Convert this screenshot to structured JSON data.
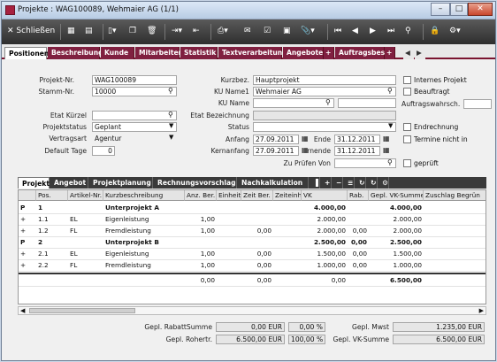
{
  "window": {
    "title": "Projekte : WAG100089, Wehmaier AG (1/1)"
  },
  "toolbar": {
    "close_label": "Schließen"
  },
  "tabs": [
    "Positionen",
    "Beschreibung",
    "Kunde",
    "Mitarbeiter",
    "Statistik",
    "Textverarbeitung",
    "Angebote",
    "Auftragsbest."
  ],
  "form": {
    "projekt_nr_label": "Projekt-Nr.",
    "projekt_nr": "WAG100089",
    "stamm_nr_label": "Stamm-Nr.",
    "stamm_nr": "10000",
    "etat_kuerzel_label": "Etat Kürzel",
    "etat_kuerzel": "",
    "projektstatus_label": "Projektstatus",
    "projektstatus": "Geplant",
    "vertragsart_label": "Vertragsart",
    "vertragsart": "Agentur",
    "default_tage_label": "Default Tage",
    "default_tage": "0",
    "kurzbez_label": "Kurzbez.",
    "kurzbez": "Hauptprojekt",
    "ku_name1_label": "KU Name1",
    "ku_name1": "Wehmaier AG",
    "ku_name_label": "KU Name",
    "ku_name": "",
    "etat_bez_label": "Etat Bezeichnung",
    "etat_bez": "",
    "status_label": "Status",
    "status": "",
    "anfang_label": "Anfang",
    "anfang": "27.09.2011",
    "ende_label": "Ende",
    "ende": "31.12.2011",
    "kernanfang_label": "Kernanfang",
    "kernanfang": "27.09.2011",
    "kernende_label": "rnende",
    "kernende": "31.12.2011",
    "zu_pruefen_label": "Zu Prüfen Von",
    "zu_pruefen": "",
    "internes_projekt": "Internes Projekt",
    "beauftragt": "Beauftragt",
    "auftragswahrsch_label": "Auftragswahrsch.",
    "endrechnung": "Endrechnung",
    "termine_nicht_in": "Termine nicht in",
    "geprueft": "geprüft"
  },
  "subtabs": [
    "Projekt",
    "Angebot",
    "Projektplanung",
    "Rechnungsvorschlag",
    "Nachkalkulation"
  ],
  "grid": {
    "headers": [
      "",
      "Pos.",
      "Artikel-Nr.",
      "Kurzbeschreibung",
      "Anz. Ber.",
      "Einheit",
      "Zeit Ber.",
      "Zeiteinh",
      "VK",
      "Rab.",
      "Gepl. VK-Summe",
      "Zuschlag Begrün"
    ],
    "rows": [
      [
        "P",
        "1",
        "",
        "Unterprojekt A",
        "",
        "",
        "",
        "",
        "4.000,00",
        "",
        "4.000,00",
        ""
      ],
      [
        "+",
        "1.1",
        "EL",
        "Eigenleistung",
        "1,00",
        "",
        "",
        "",
        "2.000,00",
        "",
        "2.000,00",
        ""
      ],
      [
        "+",
        "1.2",
        "FL",
        "Fremdleistung",
        "1,00",
        "",
        "0,00",
        "",
        "2.000,00",
        "0,00",
        "2.000,00",
        ""
      ],
      [
        "P",
        "2",
        "",
        "Unterprojekt B",
        "",
        "",
        "",
        "",
        "2.500,00",
        "0,00",
        "2.500,00",
        ""
      ],
      [
        "+",
        "2.1",
        "EL",
        "Eigenleistung",
        "1,00",
        "",
        "0,00",
        "",
        "1.500,00",
        "0,00",
        "1.500,00",
        ""
      ],
      [
        "+",
        "2.2",
        "FL",
        "Fremdleistung",
        "1,00",
        "",
        "0,00",
        "",
        "1.000,00",
        "0,00",
        "1.000,00",
        ""
      ],
      [
        "",
        "",
        "",
        "",
        "0,00",
        "",
        "0,00",
        "",
        "0,00",
        "",
        "6.500,00",
        ""
      ]
    ]
  },
  "summary": {
    "rabatt_label": "Gepl. RabattSumme",
    "rabatt": "0,00 EUR",
    "rabatt_pct": "0,00 %",
    "rohertr_label": "Gepl. Rohertr.",
    "rohertr": "6.500,00 EUR",
    "rohertr_pct": "100,00 %",
    "mwst_label": "Gepl. Mwst",
    "mwst": "1.235,00 EUR",
    "vksumme_label": "Gepl. VK-Summe",
    "vksumme": "6.500,00 EUR"
  }
}
